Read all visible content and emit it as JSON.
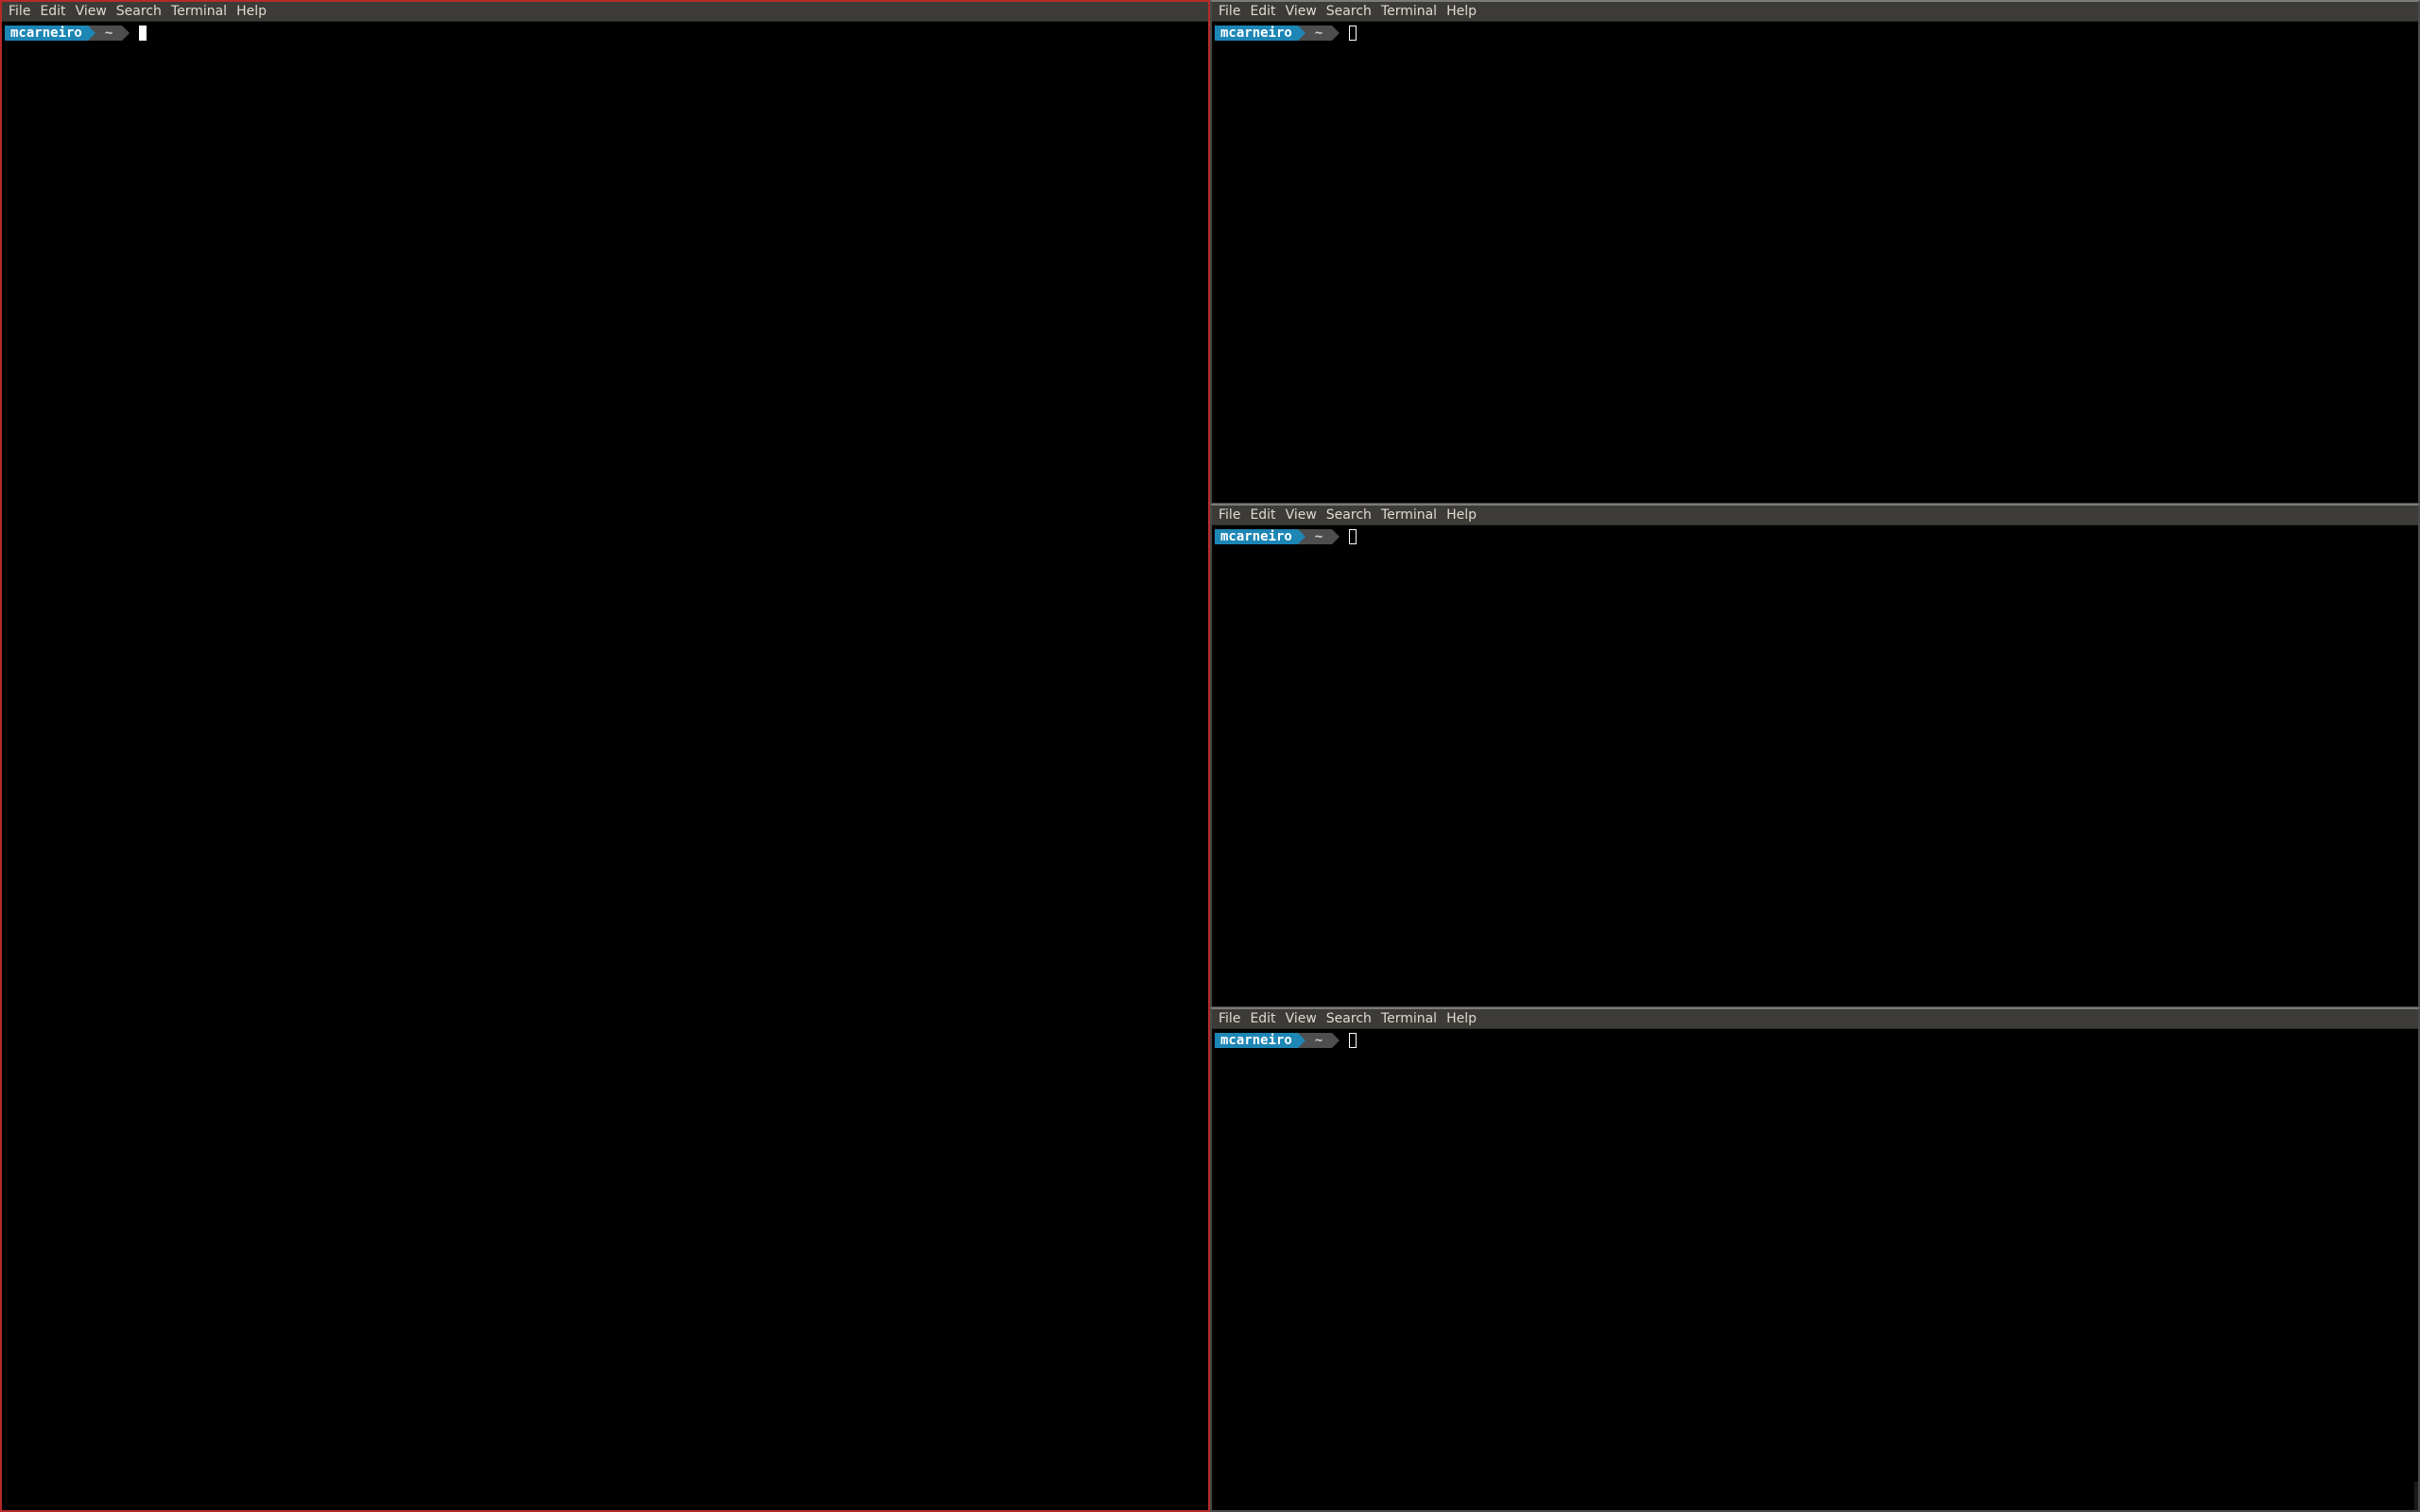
{
  "menu": {
    "file": "File",
    "edit": "Edit",
    "view": "View",
    "search": "Search",
    "terminal": "Terminal",
    "help": "Help"
  },
  "prompt": {
    "user": "mcarneiro",
    "dir": "~"
  },
  "colors": {
    "focused_border": "#b52a2a",
    "menubar_bg": "#3c3b37",
    "menu_text": "#dfdbd2",
    "prompt_user_bg": "#1d86b5",
    "prompt_dir_bg": "#4e4e4e",
    "terminal_bg": "#000000"
  },
  "terminals": [
    {
      "id": "left",
      "focused": true,
      "cursor": "solid"
    },
    {
      "id": "top-right",
      "focused": false,
      "cursor": "hollow"
    },
    {
      "id": "middle-right",
      "focused": false,
      "cursor": "hollow"
    },
    {
      "id": "bottom-right",
      "focused": false,
      "cursor": "hollow"
    }
  ]
}
